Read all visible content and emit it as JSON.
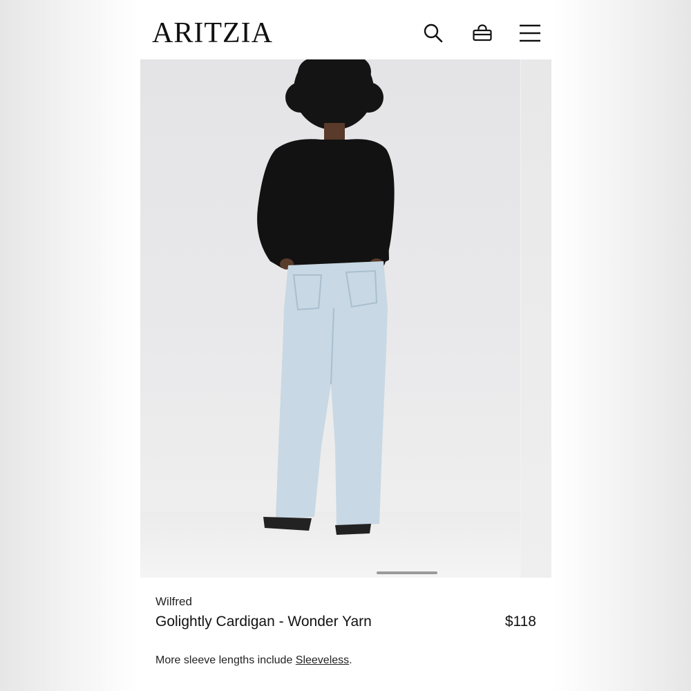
{
  "header": {
    "logo_text": "ARITZIA",
    "icons": [
      "search-icon",
      "bag-icon",
      "menu-icon"
    ]
  },
  "gallery": {
    "image_subject": "model-back-view-cardigan-jeans"
  },
  "product": {
    "brand": "Wilfred",
    "name": "Golightly Cardigan - Wonder Yarn",
    "price": "$118",
    "note_prefix": "More sleeve lengths include ",
    "note_link": "Sleeveless",
    "note_suffix": "."
  },
  "colors": {
    "text": "#111111",
    "background": "#ffffff",
    "image_bg": "#e6e6e8"
  }
}
